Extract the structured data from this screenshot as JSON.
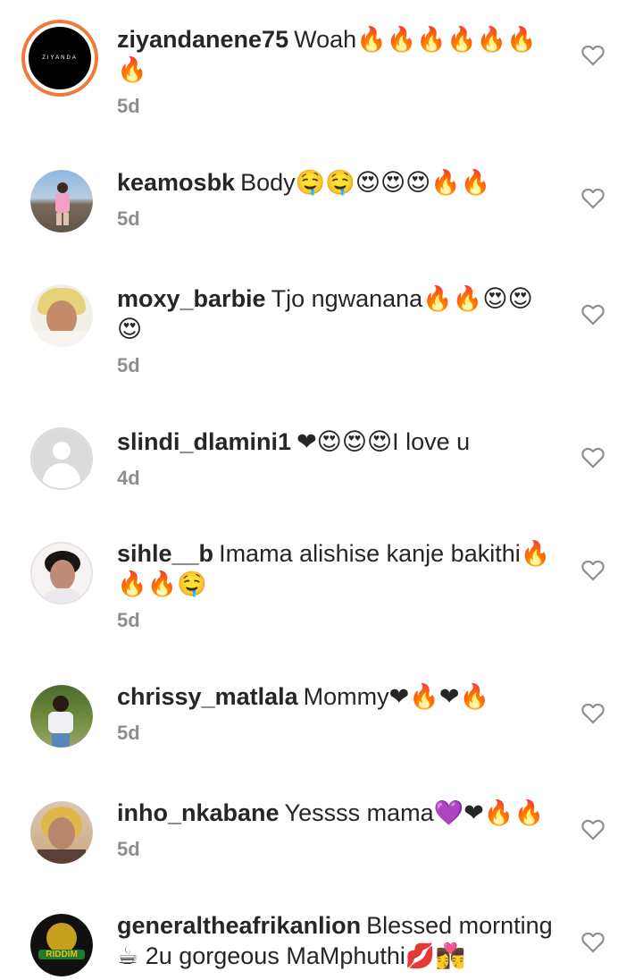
{
  "comments": [
    {
      "username": "ziyandanene75",
      "text": "Woah🔥🔥🔥🔥🔥🔥🔥",
      "time": "5d",
      "avatar_text": "ZIYANDA"
    },
    {
      "username": "keamosbk",
      "text": "Body🤤🤤😍😍😍🔥🔥",
      "time": "5d"
    },
    {
      "username": "moxy_barbie",
      "text": "Tjo ngwanana🔥🔥😍😍😍",
      "time": "5d"
    },
    {
      "username": "slindi_dlamini1",
      "text": "❤😍😍😍I love u",
      "time": "4d"
    },
    {
      "username": "sihle__b",
      "text": "Imama alishise kanje bakithi🔥🔥🔥🤤",
      "time": "5d"
    },
    {
      "username": "chrissy_matlala",
      "text": "Mommy❤🔥❤🔥",
      "time": "5d"
    },
    {
      "username": "inho_nkabane",
      "text": "Yessss mama💜❤🔥🔥",
      "time": "5d"
    },
    {
      "username": "generaltheafrikanlion",
      "text": "Blessed mornting ☕ 2u gorgeous MaMphuthi💋👩‍❤️‍💋‍👨",
      "avatar_text": "RIDDIM"
    }
  ],
  "icons": {
    "like": "heart-outline-icon"
  },
  "colors": {
    "text": "#262626",
    "secondary": "#8e8e8e",
    "story_ring": "#f07a3a"
  }
}
